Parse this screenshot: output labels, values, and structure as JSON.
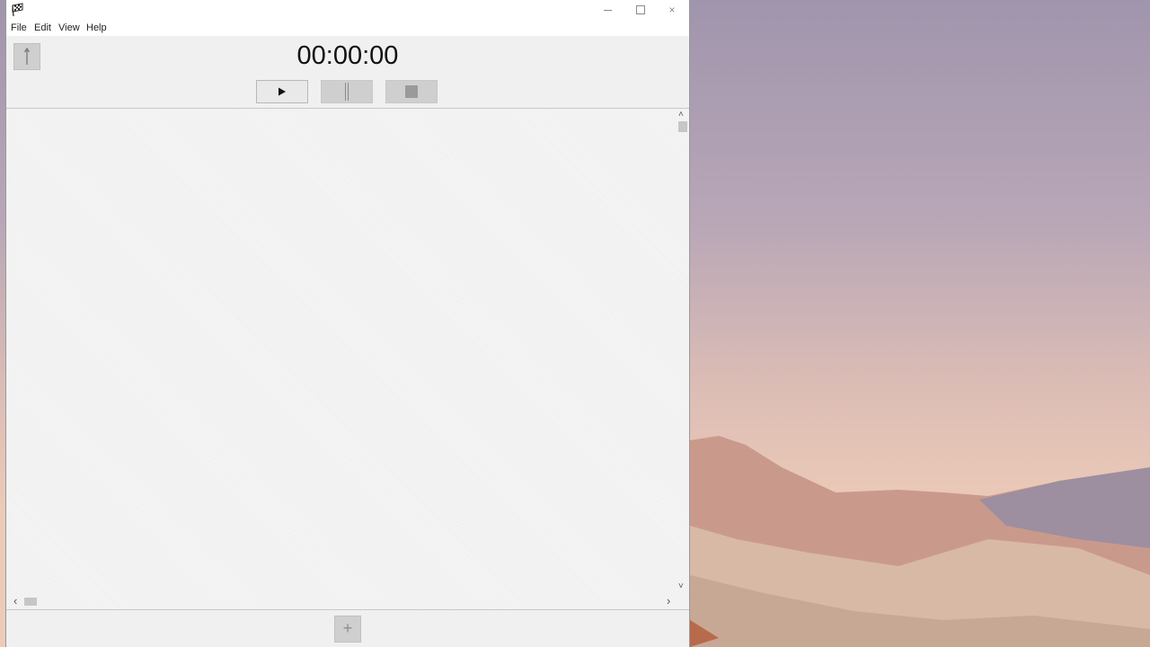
{
  "window": {
    "menu": [
      "File",
      "Edit",
      "View",
      "Help"
    ],
    "controls": {
      "minimize": "minimize",
      "maximize": "maximize",
      "close": "close"
    }
  },
  "timer": {
    "display": "00:00:00"
  },
  "toolbar": {
    "sort_icon": "up-arrow-icon",
    "play_icon": "play-icon",
    "pause_icon": "pause-icon",
    "stop_icon": "stop-icon"
  },
  "footer": {
    "add_label": "+"
  },
  "icons": {
    "close": "×",
    "h_left": "‹",
    "h_right": "›",
    "v_up": "˄",
    "v_down": "˅"
  },
  "colors": {
    "window_bg": "#f0f0f0",
    "button_disabled": "#cfcfcf",
    "button_enabled": "#e9e9e9"
  }
}
